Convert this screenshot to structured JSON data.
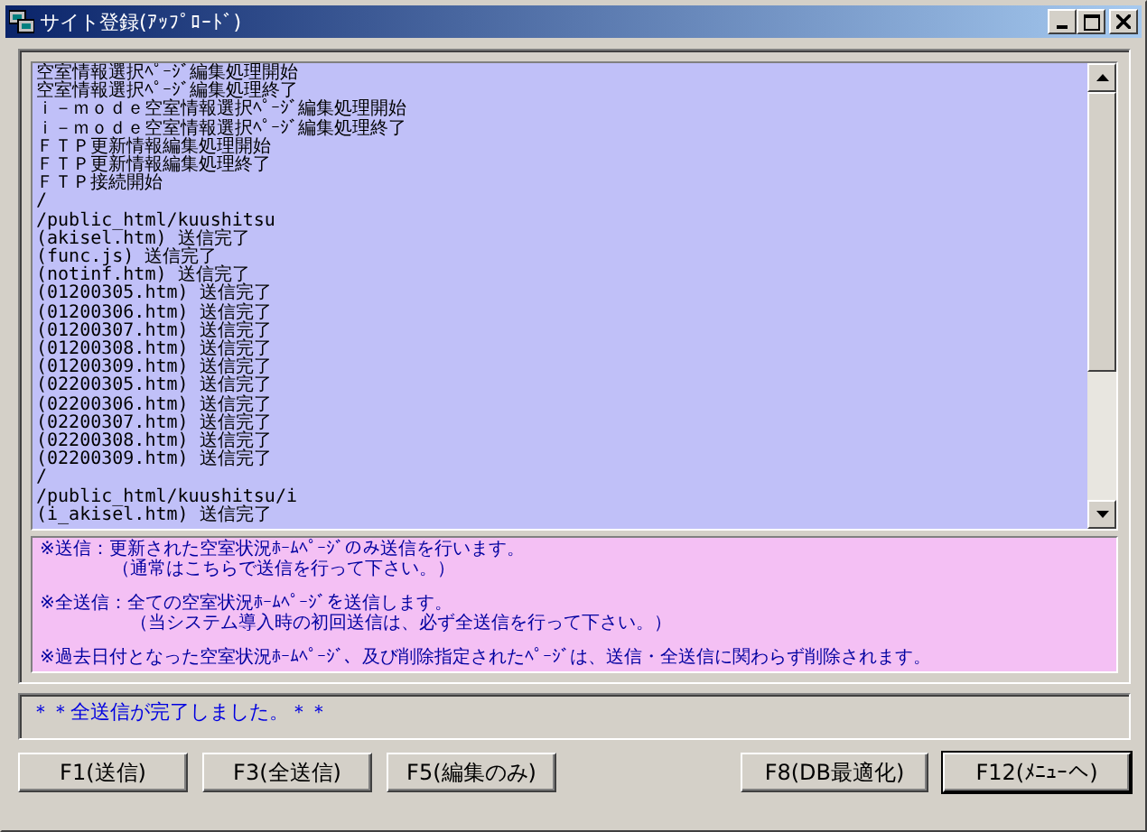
{
  "window": {
    "title": "サイト登録(ｱｯﾌﾟﾛｰﾄﾞ)"
  },
  "log": [
    "空室情報選択ﾍﾟｰｼﾞ編集処理開始",
    "空室情報選択ﾍﾟｰｼﾞ編集処理終了",
    "ｉ－ｍｏｄｅ空室情報選択ﾍﾟｰｼﾞ編集処理開始",
    "ｉ－ｍｏｄｅ空室情報選択ﾍﾟｰｼﾞ編集処理終了",
    "ＦＴＰ更新情報編集処理開始",
    "ＦＴＰ更新情報編集処理終了",
    "ＦＴＰ接続開始",
    "/",
    "/public_html/kuushitsu",
    "(akisel.htm) 送信完了",
    "(func.js) 送信完了",
    "(notinf.htm) 送信完了",
    "(01200305.htm) 送信完了",
    "(01200306.htm) 送信完了",
    "(01200307.htm) 送信完了",
    "(01200308.htm) 送信完了",
    "(01200309.htm) 送信完了",
    "(02200305.htm) 送信完了",
    "(02200306.htm) 送信完了",
    "(02200307.htm) 送信完了",
    "(02200308.htm) 送信完了",
    "(02200309.htm) 送信完了",
    "/",
    "/public_html/kuushitsu/i",
    "(i_akisel.htm) 送信完了"
  ],
  "notes": [
    {
      "lines": [
        "※送信：更新された空室状況ﾎｰﾑﾍﾟｰｼﾞのみ送信を行います。",
        "　　　　（通常はこちらで送信を行って下さい。）"
      ]
    },
    {
      "lines": [
        "※全送信：全ての空室状況ﾎｰﾑﾍﾟｰｼﾞを送信します。",
        "　　　　　（当システム導入時の初回送信は、必ず全送信を行って下さい。）"
      ]
    },
    {
      "lines": [
        "※過去日付となった空室状況ﾎｰﾑﾍﾟｰｼﾞ、及び削除指定されたﾍﾟｰｼﾞは、送信・全送信に関わらず削除されます。"
      ]
    }
  ],
  "status_message": "＊＊全送信が完了しました。＊＊",
  "buttons_left": [
    {
      "label": "F1(送信)",
      "default": false
    },
    {
      "label": "F3(全送信)",
      "default": false
    },
    {
      "label": "F5(編集のみ)",
      "default": false
    }
  ],
  "buttons_right": [
    {
      "label": "F8(DB最適化)",
      "default": false
    },
    {
      "label": "F12(ﾒﾆｭｰへ)",
      "default": true
    }
  ]
}
